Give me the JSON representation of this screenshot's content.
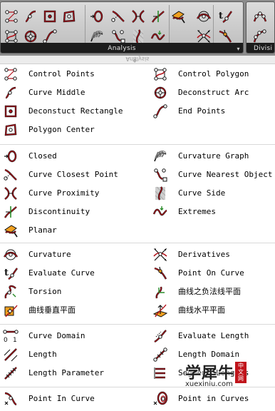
{
  "toolbar": {
    "analysis_label": "Analysis",
    "division_label": "Divisi",
    "icons": [
      "control-points-icon",
      "curve-middle-icon",
      "deconstruct-rectangle-icon",
      "polygon-center-icon",
      "control-polygon-icon",
      "deconstruct-arc-icon",
      "end-points-icon",
      "closed-icon",
      "curve-closest-point-icon",
      "curve-proximity-icon",
      "discontinuity-icon",
      "planar-icon",
      "curvature-graph-icon",
      "curve-nearest-object-icon",
      "curve-side-icon",
      "extremes-icon",
      "curvature-icon",
      "evaluate-curve-icon",
      "derivatives-icon",
      "point-on-curve-icon",
      "divide-curve-icon",
      "divide-distance-icon"
    ],
    "expand_arrow": "▾"
  },
  "mirror_text": "Analysis",
  "sections": [
    {
      "items": [
        {
          "label": "Control Points",
          "icon": "control-points-icon"
        },
        {
          "label": "Control Polygon",
          "icon": "control-polygon-icon"
        },
        {
          "label": "Curve Middle",
          "icon": "curve-middle-icon"
        },
        {
          "label": "Deconstruct Arc",
          "icon": "deconstruct-arc-icon"
        },
        {
          "label": "Deconstuct Rectangle",
          "icon": "deconstruct-rectangle-icon"
        },
        {
          "label": "End Points",
          "icon": "end-points-icon"
        },
        {
          "label": "Polygon Center",
          "icon": "polygon-center-icon"
        }
      ]
    },
    {
      "items": [
        {
          "label": "Closed",
          "icon": "closed-icon"
        },
        {
          "label": "Curvature Graph",
          "icon": "curvature-graph-icon"
        },
        {
          "label": "Curve Closest Point",
          "icon": "curve-closest-point-icon"
        },
        {
          "label": "Curve Nearest Object",
          "icon": "curve-nearest-object-icon"
        },
        {
          "label": "Curve Proximity",
          "icon": "curve-proximity-icon"
        },
        {
          "label": "Curve Side",
          "icon": "curve-side-icon"
        },
        {
          "label": "Discontinuity",
          "icon": "discontinuity-icon"
        },
        {
          "label": "Extremes",
          "icon": "extremes-icon"
        },
        {
          "label": "Planar",
          "icon": "planar-icon"
        }
      ]
    },
    {
      "items": [
        {
          "label": "Curvature",
          "icon": "curvature-icon"
        },
        {
          "label": "Derivatives",
          "icon": "derivatives-icon"
        },
        {
          "label": "Evaluate Curve",
          "icon": "evaluate-curve-icon"
        },
        {
          "label": "Point On Curve",
          "icon": "point-on-curve-icon"
        },
        {
          "label": "Torsion",
          "icon": "torsion-icon"
        },
        {
          "label": "曲线之负法线平面",
          "icon": "curve-negative-normal-plane-icon"
        },
        {
          "label": "曲线垂直平面",
          "icon": "curve-perp-plane-icon"
        },
        {
          "label": "曲线水平平面",
          "icon": "curve-horizontal-plane-icon"
        }
      ]
    },
    {
      "items": [
        {
          "label": "Curve Domain",
          "icon": "curve-domain-icon"
        },
        {
          "label": "Evaluate Length",
          "icon": "evaluate-length-icon"
        },
        {
          "label": "Length",
          "icon": "length-icon"
        },
        {
          "label": "Length Domain",
          "icon": "length-domain-icon"
        },
        {
          "label": "Length Parameter",
          "icon": "length-parameter-icon"
        },
        {
          "label": "Segment Lengths",
          "icon": "segment-lengths-icon"
        }
      ]
    },
    {
      "items": [
        {
          "label": "Point In Curve",
          "icon": "point-in-curve-icon"
        },
        {
          "label": "Point in Curves",
          "icon": "point-in-curves-icon"
        }
      ]
    }
  ],
  "watermark": {
    "text": "学犀牛",
    "badge": "中文网",
    "url": "xuexiniu.com"
  }
}
